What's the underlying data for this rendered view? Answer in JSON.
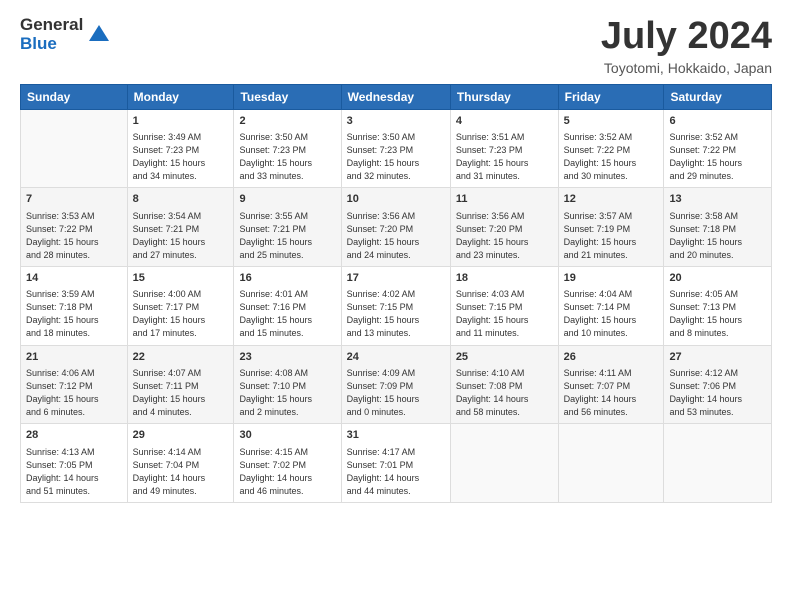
{
  "logo": {
    "general": "General",
    "blue": "Blue"
  },
  "title": "July 2024",
  "subtitle": "Toyotomi, Hokkaido, Japan",
  "days_of_week": [
    "Sunday",
    "Monday",
    "Tuesday",
    "Wednesday",
    "Thursday",
    "Friday",
    "Saturday"
  ],
  "weeks": [
    [
      {
        "day": "",
        "info": ""
      },
      {
        "day": "1",
        "info": "Sunrise: 3:49 AM\nSunset: 7:23 PM\nDaylight: 15 hours\nand 34 minutes."
      },
      {
        "day": "2",
        "info": "Sunrise: 3:50 AM\nSunset: 7:23 PM\nDaylight: 15 hours\nand 33 minutes."
      },
      {
        "day": "3",
        "info": "Sunrise: 3:50 AM\nSunset: 7:23 PM\nDaylight: 15 hours\nand 32 minutes."
      },
      {
        "day": "4",
        "info": "Sunrise: 3:51 AM\nSunset: 7:23 PM\nDaylight: 15 hours\nand 31 minutes."
      },
      {
        "day": "5",
        "info": "Sunrise: 3:52 AM\nSunset: 7:22 PM\nDaylight: 15 hours\nand 30 minutes."
      },
      {
        "day": "6",
        "info": "Sunrise: 3:52 AM\nSunset: 7:22 PM\nDaylight: 15 hours\nand 29 minutes."
      }
    ],
    [
      {
        "day": "7",
        "info": "Sunrise: 3:53 AM\nSunset: 7:22 PM\nDaylight: 15 hours\nand 28 minutes."
      },
      {
        "day": "8",
        "info": "Sunrise: 3:54 AM\nSunset: 7:21 PM\nDaylight: 15 hours\nand 27 minutes."
      },
      {
        "day": "9",
        "info": "Sunrise: 3:55 AM\nSunset: 7:21 PM\nDaylight: 15 hours\nand 25 minutes."
      },
      {
        "day": "10",
        "info": "Sunrise: 3:56 AM\nSunset: 7:20 PM\nDaylight: 15 hours\nand 24 minutes."
      },
      {
        "day": "11",
        "info": "Sunrise: 3:56 AM\nSunset: 7:20 PM\nDaylight: 15 hours\nand 23 minutes."
      },
      {
        "day": "12",
        "info": "Sunrise: 3:57 AM\nSunset: 7:19 PM\nDaylight: 15 hours\nand 21 minutes."
      },
      {
        "day": "13",
        "info": "Sunrise: 3:58 AM\nSunset: 7:18 PM\nDaylight: 15 hours\nand 20 minutes."
      }
    ],
    [
      {
        "day": "14",
        "info": "Sunrise: 3:59 AM\nSunset: 7:18 PM\nDaylight: 15 hours\nand 18 minutes."
      },
      {
        "day": "15",
        "info": "Sunrise: 4:00 AM\nSunset: 7:17 PM\nDaylight: 15 hours\nand 17 minutes."
      },
      {
        "day": "16",
        "info": "Sunrise: 4:01 AM\nSunset: 7:16 PM\nDaylight: 15 hours\nand 15 minutes."
      },
      {
        "day": "17",
        "info": "Sunrise: 4:02 AM\nSunset: 7:15 PM\nDaylight: 15 hours\nand 13 minutes."
      },
      {
        "day": "18",
        "info": "Sunrise: 4:03 AM\nSunset: 7:15 PM\nDaylight: 15 hours\nand 11 minutes."
      },
      {
        "day": "19",
        "info": "Sunrise: 4:04 AM\nSunset: 7:14 PM\nDaylight: 15 hours\nand 10 minutes."
      },
      {
        "day": "20",
        "info": "Sunrise: 4:05 AM\nSunset: 7:13 PM\nDaylight: 15 hours\nand 8 minutes."
      }
    ],
    [
      {
        "day": "21",
        "info": "Sunrise: 4:06 AM\nSunset: 7:12 PM\nDaylight: 15 hours\nand 6 minutes."
      },
      {
        "day": "22",
        "info": "Sunrise: 4:07 AM\nSunset: 7:11 PM\nDaylight: 15 hours\nand 4 minutes."
      },
      {
        "day": "23",
        "info": "Sunrise: 4:08 AM\nSunset: 7:10 PM\nDaylight: 15 hours\nand 2 minutes."
      },
      {
        "day": "24",
        "info": "Sunrise: 4:09 AM\nSunset: 7:09 PM\nDaylight: 15 hours\nand 0 minutes."
      },
      {
        "day": "25",
        "info": "Sunrise: 4:10 AM\nSunset: 7:08 PM\nDaylight: 14 hours\nand 58 minutes."
      },
      {
        "day": "26",
        "info": "Sunrise: 4:11 AM\nSunset: 7:07 PM\nDaylight: 14 hours\nand 56 minutes."
      },
      {
        "day": "27",
        "info": "Sunrise: 4:12 AM\nSunset: 7:06 PM\nDaylight: 14 hours\nand 53 minutes."
      }
    ],
    [
      {
        "day": "28",
        "info": "Sunrise: 4:13 AM\nSunset: 7:05 PM\nDaylight: 14 hours\nand 51 minutes."
      },
      {
        "day": "29",
        "info": "Sunrise: 4:14 AM\nSunset: 7:04 PM\nDaylight: 14 hours\nand 49 minutes."
      },
      {
        "day": "30",
        "info": "Sunrise: 4:15 AM\nSunset: 7:02 PM\nDaylight: 14 hours\nand 46 minutes."
      },
      {
        "day": "31",
        "info": "Sunrise: 4:17 AM\nSunset: 7:01 PM\nDaylight: 14 hours\nand 44 minutes."
      },
      {
        "day": "",
        "info": ""
      },
      {
        "day": "",
        "info": ""
      },
      {
        "day": "",
        "info": ""
      }
    ]
  ]
}
